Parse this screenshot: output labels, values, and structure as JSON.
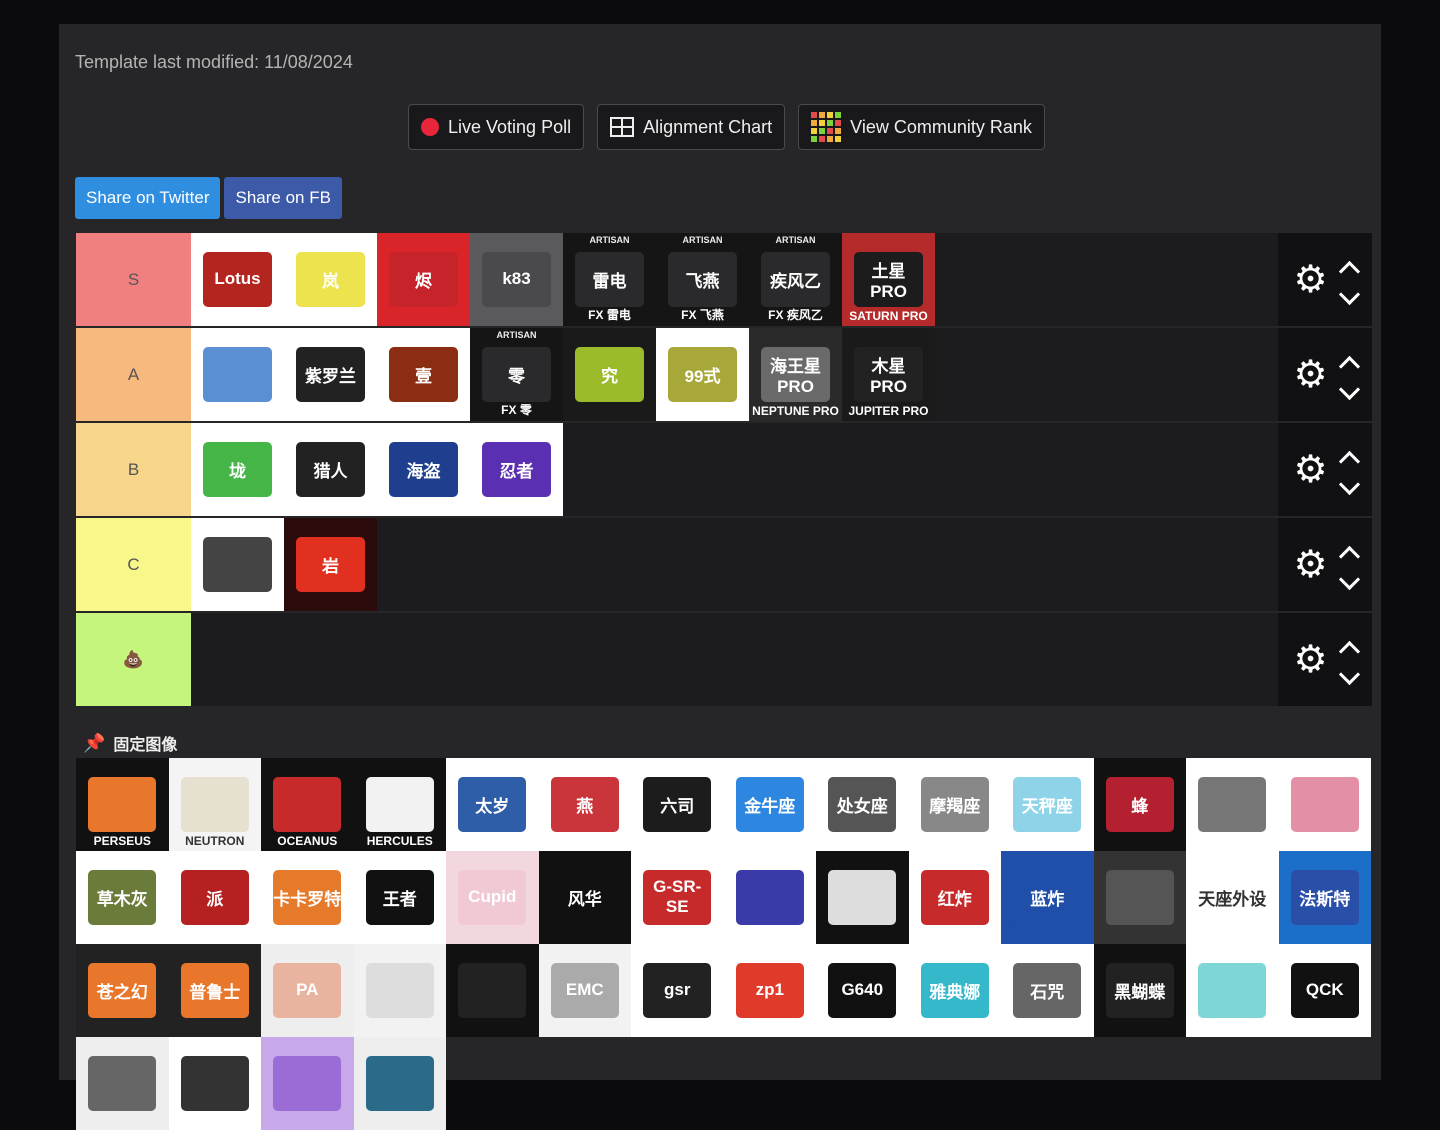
{
  "modified": "Template last modified: 11/08/2024",
  "top_buttons": [
    {
      "label": "Live Voting Poll",
      "icon": "red-dot-icon"
    },
    {
      "label": "Alignment Chart",
      "icon": "grid-icon"
    },
    {
      "label": "View Community Rank",
      "icon": "rank-grid-icon"
    }
  ],
  "share": {
    "twitter": "Share on Twitter",
    "facebook": "Share on FB"
  },
  "tiers": [
    {
      "label": "S",
      "color": "#f08080",
      "items": [
        {
          "bg": "#ffffff",
          "pad": "#b3251f",
          "text": "Lotus"
        },
        {
          "bg": "#ffffff",
          "pad": "#ece34f",
          "text": "岚"
        },
        {
          "bg": "#d9242a",
          "pad": "#c6232a",
          "text": "烬"
        },
        {
          "bg": "#5a5a5c",
          "pad": "#4a4a4c",
          "text": "k83"
        },
        {
          "bg": "#151515",
          "pad": "#2a2a2c",
          "text": "雷电",
          "top": "ARTISAN",
          "bottom": "FX 雷电"
        },
        {
          "bg": "#151515",
          "pad": "#2a2a2c",
          "text": "飞燕",
          "top": "ARTISAN",
          "bottom": "FX 飞燕"
        },
        {
          "bg": "#151515",
          "pad": "#2a2a2c",
          "text": "疾风乙",
          "top": "ARTISAN",
          "bottom": "FX 疾风乙"
        },
        {
          "bg": "#b52a2a",
          "pad": "#1c1c1c",
          "text": "土星PRO",
          "bottom": "SATURN PRO"
        }
      ]
    },
    {
      "label": "A",
      "color": "#f7b97d",
      "items": [
        {
          "bg": "#ffffff",
          "pad": "#5b8fd1",
          "text": ""
        },
        {
          "bg": "#ffffff",
          "pad": "#222222",
          "text": "紫罗兰"
        },
        {
          "bg": "#ffffff",
          "pad": "#8b2d12",
          "text": "壹"
        },
        {
          "bg": "#151515",
          "pad": "#2a2a2c",
          "text": "零",
          "top": "ARTISAN",
          "bottom": "FX 零"
        },
        {
          "bg": "#1a1a1a",
          "pad": "#9bbb2a",
          "text": "究"
        },
        {
          "bg": "#ffffff",
          "pad": "#a8a83a",
          "text": "99式"
        },
        {
          "bg": "#2a2a2a",
          "pad": "#6a6a6a",
          "text": "海王星PRO",
          "bottom": "NEPTUNE PRO"
        },
        {
          "bg": "#1a1a1a",
          "pad": "#222222",
          "text": "木星PRO",
          "bottom": "JUPITER PRO"
        }
      ]
    },
    {
      "label": "B",
      "color": "#f7d58a",
      "items": [
        {
          "bg": "#ffffff",
          "pad": "#46b547",
          "text": "垅"
        },
        {
          "bg": "#ffffff",
          "pad": "#222222",
          "text": "猎人"
        },
        {
          "bg": "#ffffff",
          "pad": "#1f3f8e",
          "text": "海盗"
        },
        {
          "bg": "#ffffff",
          "pad": "#5b2fb2",
          "text": "忍者"
        }
      ]
    },
    {
      "label": "C",
      "color": "#f7f78a",
      "items": [
        {
          "bg": "#ffffff",
          "pad": "#444444",
          "text": ""
        },
        {
          "bg": "#2a0a0a",
          "pad": "#e13020",
          "text": "岩"
        }
      ]
    },
    {
      "label": "💩",
      "color": "#c5f57d",
      "items": []
    }
  ],
  "pinned_label": "固定图像",
  "pool": [
    {
      "bg": "#111",
      "pad": "#e8762b",
      "text": "",
      "bottom": "PERSEUS"
    },
    {
      "bg": "#f4f4f4",
      "pad": "#e6e0d0",
      "text": "",
      "bottom": "NEUTRON",
      "dark": true
    },
    {
      "bg": "#111",
      "pad": "#c62a2a",
      "text": "",
      "bottom": "OCEANUS"
    },
    {
      "bg": "#111",
      "pad": "#f2f2f2",
      "text": "",
      "bottom": "HERCULES"
    },
    {
      "bg": "#fff",
      "pad": "#2f5ea8",
      "text": "太岁"
    },
    {
      "bg": "#fff",
      "pad": "#c9353a",
      "text": "燕"
    },
    {
      "bg": "#fff",
      "pad": "#1c1c1c",
      "text": "六司"
    },
    {
      "bg": "#fff",
      "pad": "#2d86e0",
      "text": "金牛座"
    },
    {
      "bg": "#fff",
      "pad": "#555",
      "text": "处女座"
    },
    {
      "bg": "#fff",
      "pad": "#888",
      "text": "摩羯座"
    },
    {
      "bg": "#fff",
      "pad": "#8fd3e8",
      "text": "天秤座"
    },
    {
      "bg": "#111",
      "pad": "#b52030",
      "text": "蜂"
    },
    {
      "bg": "#fff",
      "pad": "#777",
      "text": ""
    },
    {
      "bg": "#fff",
      "pad": "#e38fa6",
      "text": ""
    },
    {
      "bg": "#fff",
      "pad": "#6b7b3a",
      "text": "草木灰"
    },
    {
      "bg": "#fff",
      "pad": "#b52020",
      "text": "派"
    },
    {
      "bg": "#fff",
      "pad": "#e57a2a",
      "text": "卡卡罗特"
    },
    {
      "bg": "#fff",
      "pad": "#111",
      "text": "王者"
    },
    {
      "bg": "#f3d7df",
      "pad": "#f0c9d4",
      "text": "Cupid"
    },
    {
      "bg": "#111",
      "pad": "#111",
      "text": "风华"
    },
    {
      "bg": "#fff",
      "pad": "#c62a2a",
      "text": "G-SR-SE"
    },
    {
      "bg": "#fff",
      "pad": "#3a3aa8",
      "text": ""
    },
    {
      "bg": "#111",
      "pad": "#ddd",
      "text": ""
    },
    {
      "bg": "#fff",
      "pad": "#c62a2a",
      "text": "红炸"
    },
    {
      "bg": "#1f4fa8",
      "pad": "#1f4fa8",
      "text": "蓝炸"
    },
    {
      "bg": "#333",
      "pad": "#555",
      "text": ""
    },
    {
      "bg": "#fff",
      "pad": "#fff",
      "text": "天座外设",
      "dark": true
    },
    {
      "bg": "#1c6fc9",
      "pad": "#2a4fa8",
      "text": "法斯特"
    },
    {
      "bg": "#222",
      "pad": "#e8762b",
      "text": "苍之幻"
    },
    {
      "bg": "#222",
      "pad": "#e8762b",
      "text": "普鲁士"
    },
    {
      "bg": "#eee",
      "pad": "#e8b4a0",
      "text": "PA"
    },
    {
      "bg": "#f2f2f2",
      "pad": "#ddd",
      "text": ""
    },
    {
      "bg": "#111",
      "pad": "#222",
      "text": ""
    },
    {
      "bg": "#f2f2f2",
      "pad": "#aaa",
      "text": "EMC"
    },
    {
      "bg": "#fff",
      "pad": "#222",
      "text": "gsr"
    },
    {
      "bg": "#fff",
      "pad": "#e03a2a",
      "text": "zp1"
    },
    {
      "bg": "#fff",
      "pad": "#111",
      "text": "G640"
    },
    {
      "bg": "#fff",
      "pad": "#35b8c9",
      "text": "雅典娜"
    },
    {
      "bg": "#fff",
      "pad": "#666",
      "text": "石咒"
    },
    {
      "bg": "#111",
      "pad": "#222",
      "text": "黑蝴蝶"
    },
    {
      "bg": "#fff",
      "pad": "#7fd6d6",
      "text": ""
    },
    {
      "bg": "#fff",
      "pad": "#111",
      "text": "QCK"
    },
    {
      "bg": "#eee",
      "pad": "#666",
      "text": ""
    },
    {
      "bg": "#fff",
      "pad": "#333",
      "text": ""
    },
    {
      "bg": "#c7a8e8",
      "pad": "#9b6bd6",
      "text": ""
    },
    {
      "bg": "#eee",
      "pad": "#2a6b8a",
      "text": ""
    }
  ]
}
